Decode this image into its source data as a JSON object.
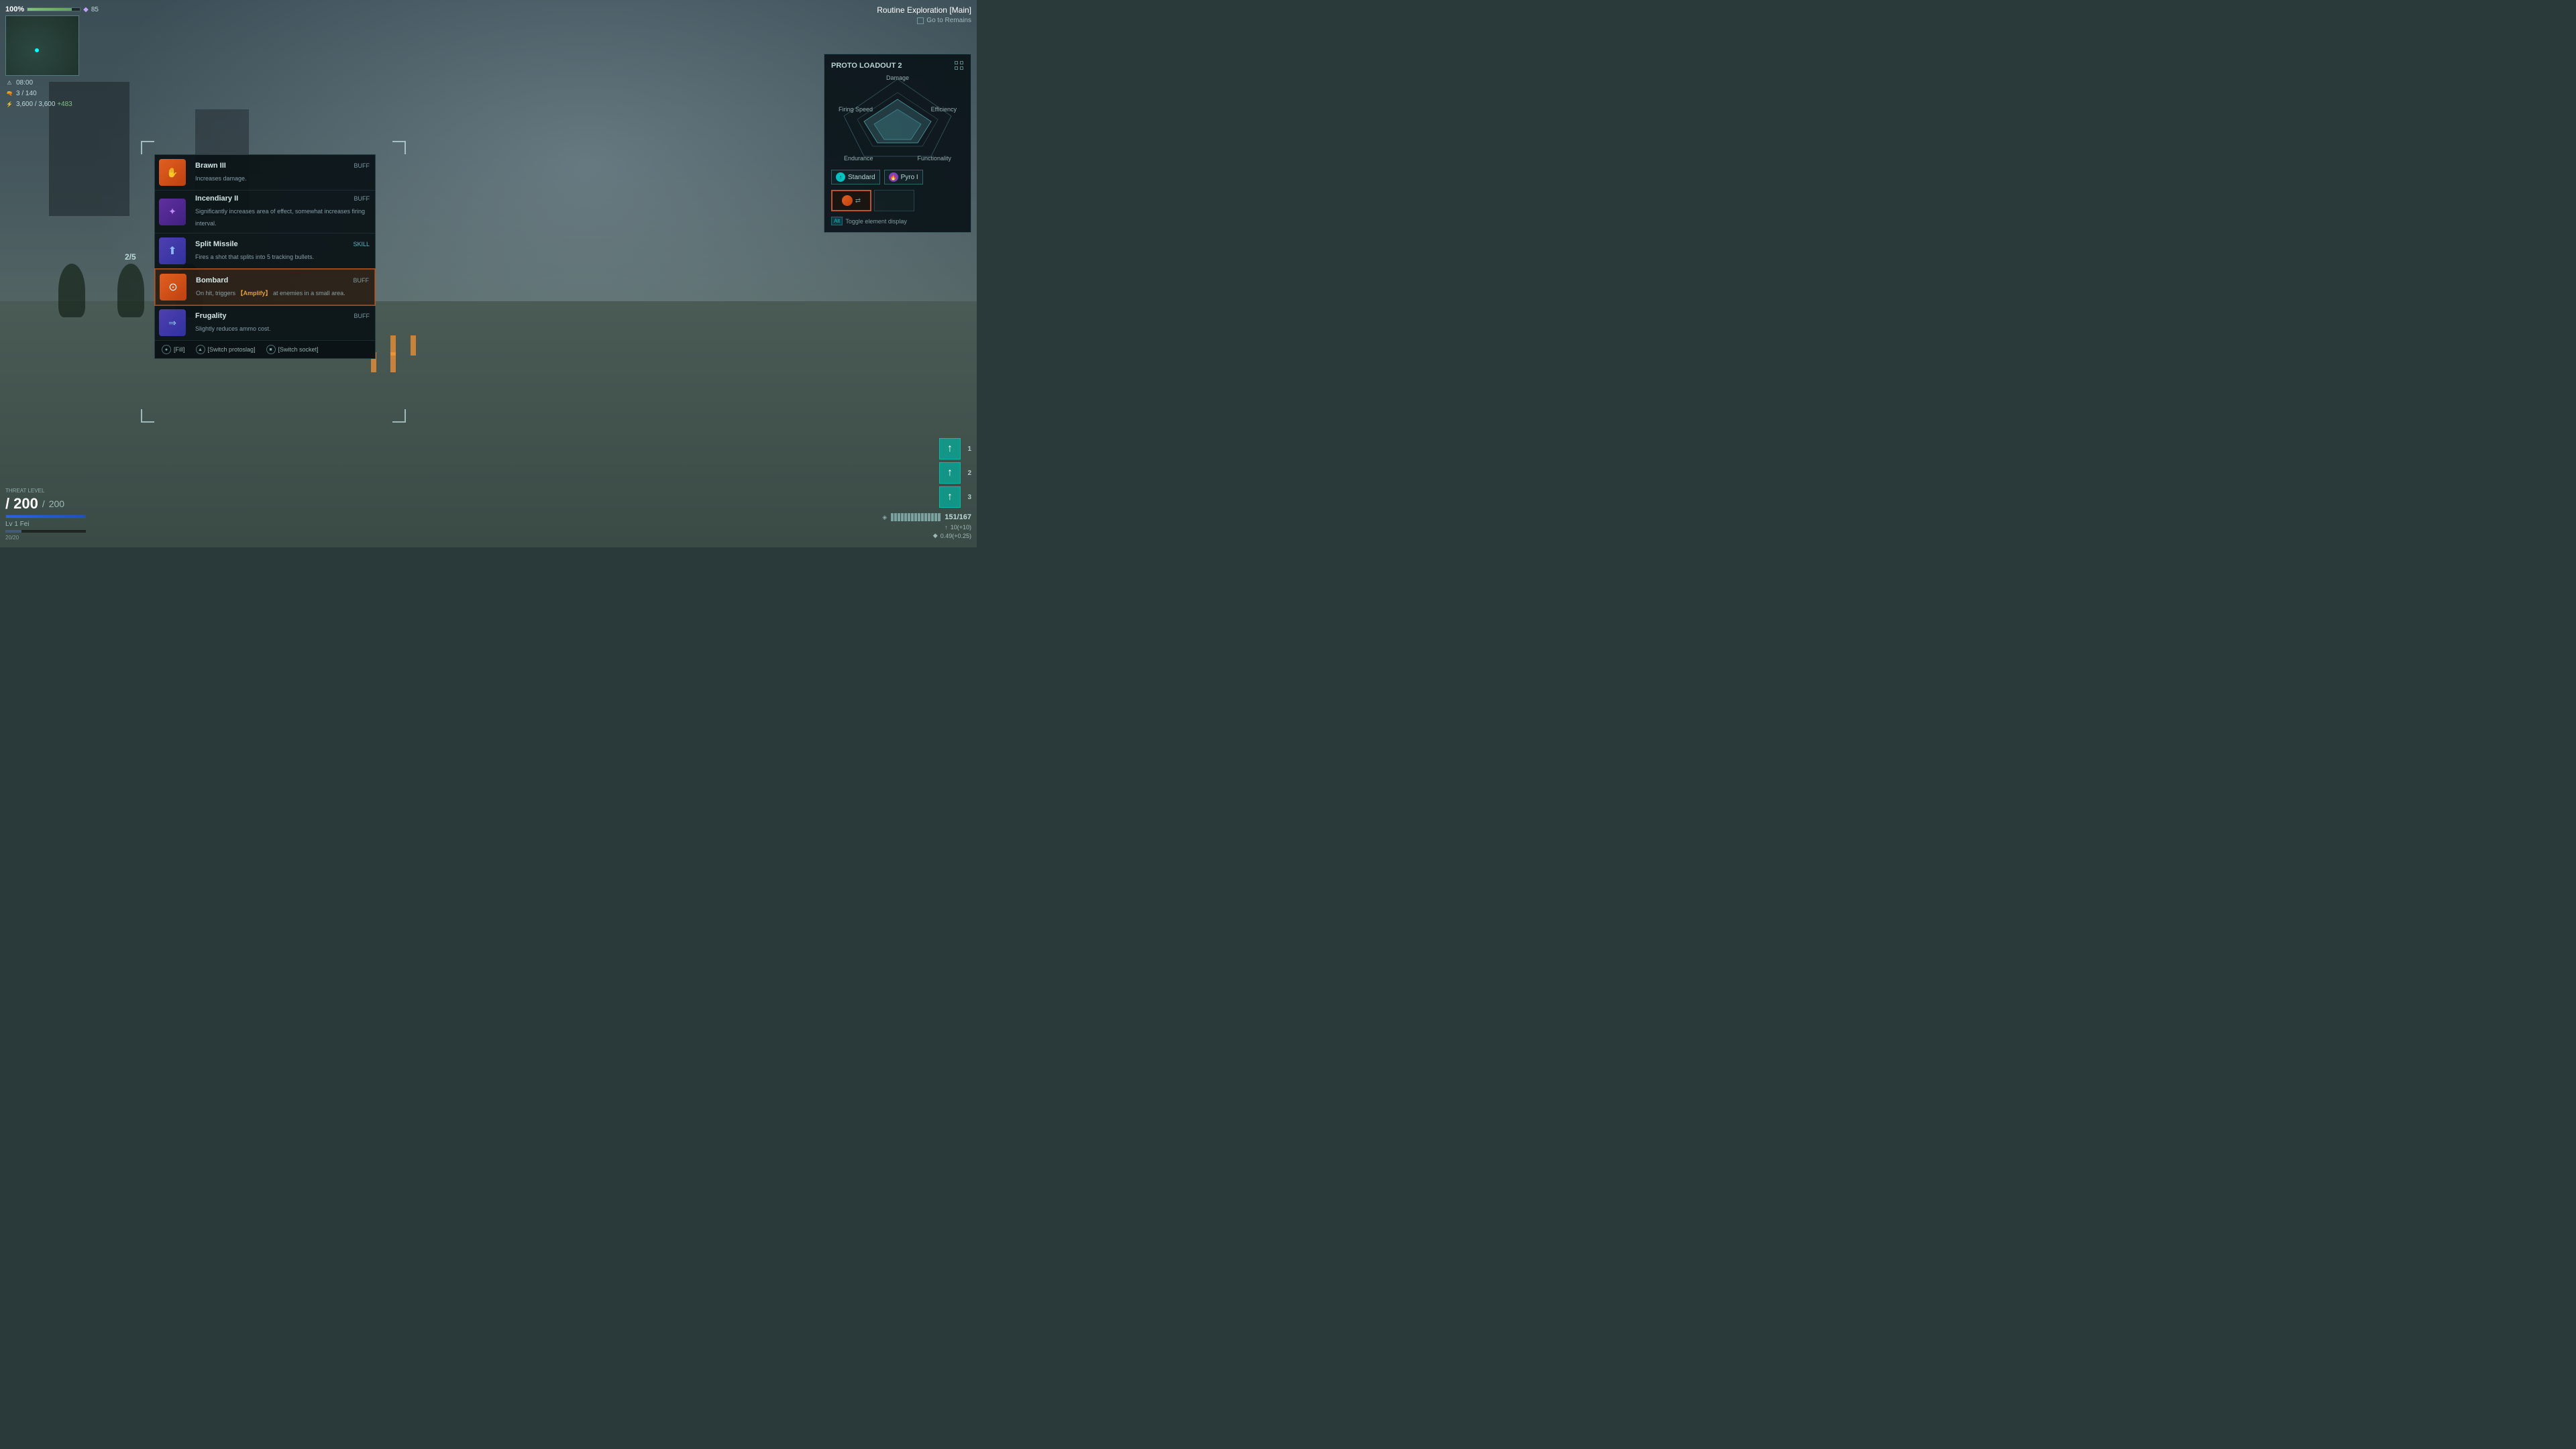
{
  "game": {
    "bg_color": "#3a4a50"
  },
  "hud": {
    "health_percent": "100%",
    "crystal_count": "85",
    "time": "08:00",
    "ammo_current": "3",
    "ammo_max": "140",
    "energy_current": "3,600",
    "energy_max": "3,600",
    "energy_regen": "+483"
  },
  "minimap": {
    "label": "minimap"
  },
  "routine": {
    "title": "Routine Exploration [Main]",
    "checkbox_label": "Go to Remains"
  },
  "loadout": {
    "title": "PROTO LOADOUT 2",
    "stats": {
      "damage": "Damage",
      "firing_speed": "Firing Speed",
      "efficiency": "Efficiency",
      "endurance": "Endurance",
      "functionality": "Functionality"
    },
    "abilities": [
      {
        "name": "Standard",
        "icon_type": "cyan"
      },
      {
        "name": "Pyro I",
        "icon_type": "purple"
      }
    ],
    "toggle_key": "Alt",
    "toggle_label": "Toggle element display"
  },
  "ability_list": {
    "counter": "2/5",
    "items": [
      {
        "name": "Brawn III",
        "tag": "BUFF",
        "description": "Increases damage.",
        "icon_type": "orange",
        "icon_symbol": "✋",
        "selected": false
      },
      {
        "name": "Incendiary II",
        "tag": "BUFF",
        "description": "Significantly increases area of effect, somewhat increases firing interval.",
        "icon_type": "purple_dark",
        "icon_symbol": "✦",
        "selected": false
      },
      {
        "name": "Split Missile",
        "tag": "SKILL",
        "description": "Fires a shot that splits into 5 tracking bullets.",
        "icon_type": "purple_light",
        "icon_symbol": "↑",
        "selected": false
      },
      {
        "name": "Bombard",
        "tag": "BUFF",
        "description": "On hit, triggers 【Amplify】 at enemies in a small area.",
        "icon_type": "orange_selected",
        "icon_symbol": "⊙",
        "selected": true
      },
      {
        "name": "Frugality",
        "tag": "BUFF",
        "description": "Slightly reduces ammo cost.",
        "icon_type": "purple_mid",
        "icon_symbol": "→",
        "selected": false
      }
    ],
    "controls": [
      {
        "key": "●",
        "label": "[Fill]"
      },
      {
        "key": "▲",
        "label": "[Switch protoslag]"
      },
      {
        "key": "■",
        "label": "[Switch socket]"
      }
    ]
  },
  "bottom_right": {
    "skill_slots": [
      {
        "number": "1"
      },
      {
        "number": "2"
      },
      {
        "number": "3"
      }
    ],
    "ammo_current": "151",
    "ammo_max": "167",
    "resource1_label": "10(+10)",
    "resource2_label": "0.49(+0.25)"
  },
  "bottom_left": {
    "threat_level": "THREAT LEVEL",
    "hp_current": "200",
    "hp_max": "200",
    "player_level": "Lv 1",
    "player_name": "Fei",
    "exp_fraction": "20/20"
  }
}
